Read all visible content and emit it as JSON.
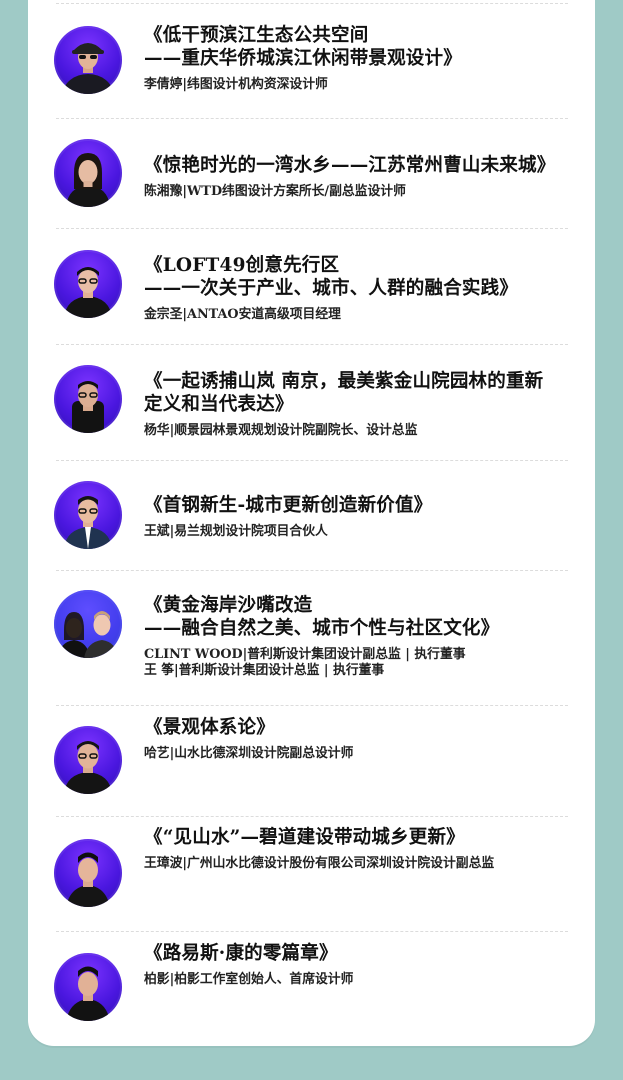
{
  "accent": "#9fcac6",
  "avatar_bg": "#4b17e0",
  "items": [
    {
      "title": "《低干预滨江生态公共空间\n——重庆华侨城滨江休闲带景观设计》",
      "meta": "李倩婷|纬图设计机构资深设计师",
      "avatar_icon": "person-photo-icon"
    },
    {
      "title": "《惊艳时光的一湾水乡——江苏常州曹山未来城》",
      "meta": "陈湘豫|WTD纬图设计方案所长/副总监设计师",
      "avatar_icon": "person-photo-icon"
    },
    {
      "title": "《LOFT49创意先行区\n——一次关于产业、城市、人群的融合实践》",
      "meta": "金宗圣|ANTAO安道高级项目经理",
      "avatar_icon": "person-photo-icon"
    },
    {
      "title": "《一起诱捕山岚 南京，最美紫金山院园林的重新\n定义和当代表达》",
      "meta": "杨华|顺景园林景观规划设计院副院长、设计总监",
      "avatar_icon": "person-photo-icon"
    },
    {
      "title": "《首钢新生-城市更新创造新价值》",
      "meta": "王斌|易兰规划设计院项目合伙人",
      "avatar_icon": "person-photo-icon"
    },
    {
      "title": "《黄金海岸沙嘴改造\n——融合自然之美、城市个性与社区文化》",
      "meta": "CLINT WOOD|普利斯设计集团设计副总监 | 执行董事\n王  筝|普利斯设计集团设计总监 | 执行董事",
      "avatar_icon": "two-person-photo-icon"
    },
    {
      "title": "《景观体系论》",
      "meta": "哈艺|山水比德深圳设计院副总设计师",
      "avatar_icon": "person-photo-icon"
    },
    {
      "title": "《“见山水”—碧道建设带动城乡更新》",
      "meta": "王璋波|广州山水比德设计股份有限公司深圳设计院设计副总监",
      "avatar_icon": "person-photo-icon"
    },
    {
      "title": "《路易斯·康的零篇章》",
      "meta": "柏影|柏影工作室创始人、首席设计师",
      "avatar_icon": "person-photo-icon"
    }
  ]
}
